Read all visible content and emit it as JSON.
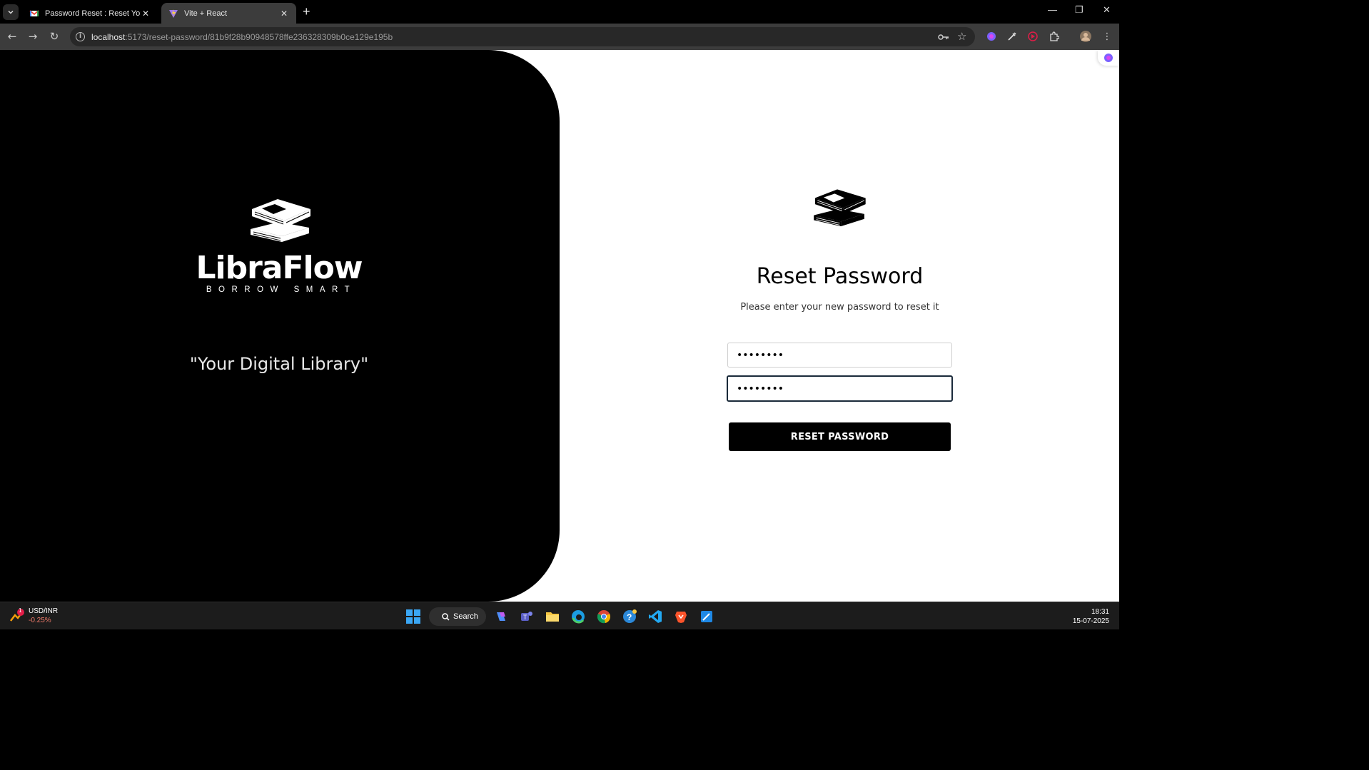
{
  "browser": {
    "tabs": [
      {
        "title": "Password Reset : Reset Your Pa",
        "favicon": "gmail-icon",
        "active": false
      },
      {
        "title": "Vite + React",
        "favicon": "vite-icon",
        "active": true
      }
    ],
    "new_tab_label": "+",
    "window_controls": {
      "minimize": "—",
      "restore": "❐",
      "close": "✕"
    },
    "url_host": "localhost",
    "url_path": ":5173/reset-password/81b9f28b90948578ffe236328309b0ce129e195b"
  },
  "brand": {
    "name": "LibraFlow",
    "tagline": "BORROW SMART",
    "quote": "\"Your Digital Library\""
  },
  "form": {
    "title": "Reset Password",
    "subtitle": "Please enter your new password to reset it",
    "new_password_value": "password",
    "confirm_password_value": "password",
    "submit_label": "RESET PASSWORD"
  },
  "taskbar": {
    "widget_title": "USD/INR",
    "widget_value": "-0.25%",
    "widget_badge": "1",
    "search_label": "Search",
    "time": "18:31",
    "date": "15-07-2025"
  },
  "colors": {
    "left_panel": "#000000",
    "button": "#000000",
    "page_bg": "#ffffff",
    "negative": "#f07a6a"
  }
}
